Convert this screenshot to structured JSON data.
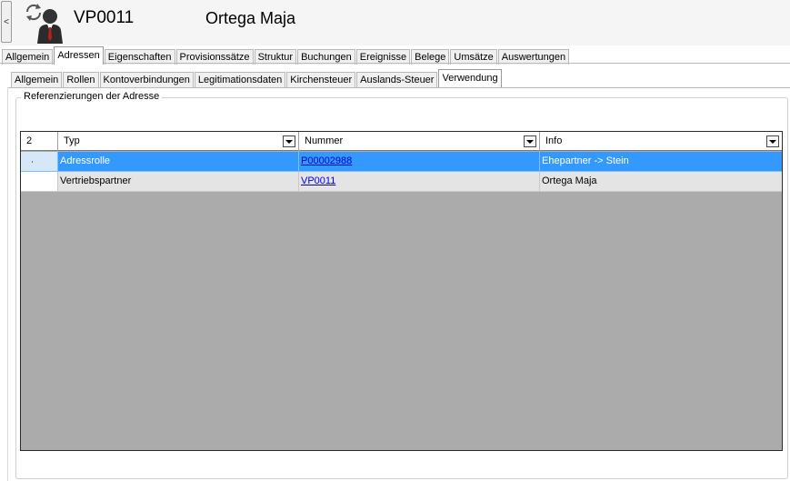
{
  "header": {
    "collapse_label": "<",
    "icon": "user-sync-icon",
    "code": "VP0011",
    "name": "Ortega Maja"
  },
  "main_tabs": [
    {
      "label": "Allgemein",
      "active": false
    },
    {
      "label": "Adressen",
      "active": true
    },
    {
      "label": "Eigenschaften",
      "active": false
    },
    {
      "label": "Provisionssätze",
      "active": false
    },
    {
      "label": "Struktur",
      "active": false
    },
    {
      "label": "Buchungen",
      "active": false
    },
    {
      "label": "Ereignisse",
      "active": false
    },
    {
      "label": "Belege",
      "active": false
    },
    {
      "label": "Umsätze",
      "active": false
    },
    {
      "label": "Auswertungen",
      "active": false
    }
  ],
  "sub_tabs": [
    {
      "label": "Allgemein",
      "active": false
    },
    {
      "label": "Rollen",
      "active": false
    },
    {
      "label": "Kontoverbindungen",
      "active": false
    },
    {
      "label": "Legitimationsdaten",
      "active": false
    },
    {
      "label": "Kirchensteuer",
      "active": false
    },
    {
      "label": "Auslands-Steuer",
      "active": false
    },
    {
      "label": "Verwendung",
      "active": true
    }
  ],
  "group": {
    "title": "Referenzierungen der Adresse"
  },
  "grid": {
    "row_count": "2",
    "columns": [
      "Typ",
      "Nummer",
      "Info"
    ],
    "rows": [
      {
        "typ": "Adressrolle",
        "nummer": "P00002988",
        "info": "Ehepartner -> Stein",
        "selected": true
      },
      {
        "typ": "Vertriebspartner",
        "nummer": "VP0011",
        "info": "Ortega Maja",
        "selected": false
      }
    ]
  },
  "colors": {
    "selection": "#3399ff",
    "link": "#0000ee",
    "grid_background": "#ababab"
  }
}
